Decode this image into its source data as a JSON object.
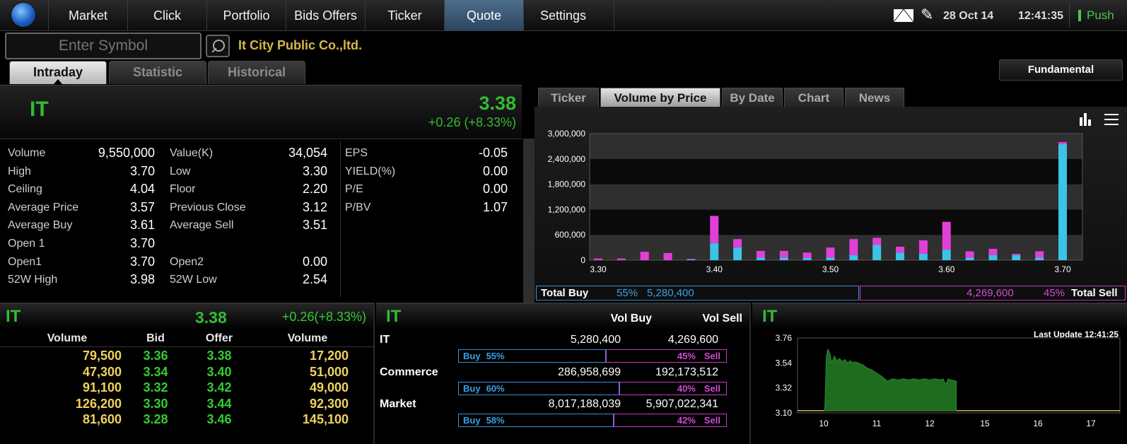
{
  "nav": {
    "items": [
      {
        "label": "Market",
        "active": false
      },
      {
        "label": "Click",
        "active": false
      },
      {
        "label": "Portfolio",
        "active": false
      },
      {
        "label": "Bids Offers",
        "active": false
      },
      {
        "label": "Ticker",
        "active": false
      },
      {
        "label": "Quote",
        "active": true
      },
      {
        "label": "Settings",
        "active": false
      }
    ],
    "date": "28 Oct 14",
    "time": "12:41:35",
    "push_label": "Push",
    "icons": [
      "mail-icon",
      "pen-icon"
    ]
  },
  "symbol_bar": {
    "placeholder": "Enter Symbol",
    "company": "It City Public Co.,ltd.",
    "tabs": [
      {
        "label": "Intraday",
        "active": true
      },
      {
        "label": "Statistic",
        "active": false
      },
      {
        "label": "Historical",
        "active": false
      }
    ],
    "fundamental_label": "Fundamental"
  },
  "quote": {
    "symbol": "IT",
    "last": "3.38",
    "change": "+0.26 (+8.33%)",
    "stats_col1": [
      {
        "label": "Volume",
        "value": "9,550,000"
      },
      {
        "label": "High",
        "value": "3.70"
      },
      {
        "label": "Ceiling",
        "value": "4.04"
      },
      {
        "label": "Average Price",
        "value": "3.57"
      },
      {
        "label": "Average Buy",
        "value": "3.61"
      },
      {
        "label": "Open 1",
        "value": "3.70"
      },
      {
        "label": "Open1",
        "value": "3.70"
      },
      {
        "label": "52W High",
        "value": "3.98"
      }
    ],
    "stats_col2": [
      {
        "label": "Value(K)",
        "value": "34,054"
      },
      {
        "label": "Low",
        "value": "3.30"
      },
      {
        "label": "Floor",
        "value": "2.20"
      },
      {
        "label": "Previous Close",
        "value": "3.12"
      },
      {
        "label": "Average Sell",
        "value": "3.51"
      },
      {
        "label": "",
        "value": ""
      },
      {
        "label": "Open2",
        "value": "0.00"
      },
      {
        "label": "52W Low",
        "value": "2.54"
      }
    ],
    "stats_col3": [
      {
        "label": "EPS",
        "value": "-0.05"
      },
      {
        "label": "YIELD(%)",
        "value": "0.00"
      },
      {
        "label": "P/E",
        "value": "0.00"
      },
      {
        "label": "P/BV",
        "value": "1.07"
      }
    ]
  },
  "right_tabs": [
    {
      "label": "Ticker",
      "active": false
    },
    {
      "label": "Volume by Price",
      "active": true
    },
    {
      "label": "By Date",
      "active": false
    },
    {
      "label": "Chart",
      "active": false
    },
    {
      "label": "News",
      "active": false
    }
  ],
  "chart_data": [
    {
      "type": "bar",
      "stacked": true,
      "x": [
        3.3,
        3.32,
        3.34,
        3.36,
        3.38,
        3.4,
        3.42,
        3.44,
        3.46,
        3.48,
        3.5,
        3.52,
        3.54,
        3.56,
        3.58,
        3.6,
        3.62,
        3.64,
        3.66,
        3.68,
        3.7
      ],
      "series": [
        {
          "name": "Total Buy",
          "color": "#3cc3e8",
          "values": [
            0,
            0,
            0,
            0,
            20000,
            400000,
            300000,
            60000,
            60000,
            50000,
            60000,
            120000,
            360000,
            180000,
            150000,
            250000,
            60000,
            120000,
            120000,
            60000,
            2750000
          ]
        },
        {
          "name": "Total Sell",
          "color": "#e040d8",
          "values": [
            40000,
            40000,
            200000,
            170000,
            10000,
            650000,
            200000,
            160000,
            160000,
            130000,
            240000,
            380000,
            170000,
            140000,
            320000,
            660000,
            150000,
            150000,
            30000,
            150000,
            50000
          ]
        }
      ],
      "x_ticks": [
        "3.30",
        "3.40",
        "3.50",
        "3.60",
        "3.70"
      ],
      "y_ticks": [
        "0",
        "600,000",
        "1,200,000",
        "1,800,000",
        "2,400,000",
        "3,000,000"
      ],
      "ylim": [
        0,
        3000000
      ],
      "grid": true,
      "legend": {
        "buy_label": "Total Buy",
        "buy_pct": "55%",
        "buy_vol": "5,280,400",
        "sell_label": "Total Sell",
        "sell_pct": "45%",
        "sell_vol": "4,269,600",
        "buy_color": "#3a9fe8",
        "sell_color": "#d64ad6"
      }
    },
    {
      "type": "area",
      "title": "IT",
      "last_update": "Last Update 12:41:25",
      "x_ticks": [
        "10",
        "11",
        "12",
        "15",
        "16",
        "17"
      ],
      "y_ticks": [
        "3.10",
        "3.32",
        "3.54",
        "3.76"
      ],
      "ylim": [
        3.1,
        3.76
      ],
      "baseline": 3.12,
      "x": [
        10.0,
        10.02,
        10.05,
        10.08,
        10.12,
        10.15,
        10.2,
        10.25,
        10.3,
        10.35,
        10.4,
        10.45,
        10.5,
        10.55,
        10.6,
        10.7,
        10.75,
        10.8,
        10.9,
        11.0,
        11.1,
        11.2,
        11.3,
        11.4,
        11.5,
        11.6,
        11.7,
        11.8,
        11.9,
        12.0,
        12.1,
        12.2,
        12.25,
        12.3,
        12.35,
        12.4,
        12.5
      ],
      "values": [
        3.12,
        3.12,
        3.6,
        3.66,
        3.62,
        3.54,
        3.6,
        3.56,
        3.58,
        3.55,
        3.57,
        3.54,
        3.56,
        3.54,
        3.55,
        3.53,
        3.52,
        3.5,
        3.48,
        3.45,
        3.42,
        3.38,
        3.4,
        3.39,
        3.4,
        3.39,
        3.4,
        3.39,
        3.4,
        3.39,
        3.4,
        3.39,
        3.4,
        3.35,
        3.4,
        3.39,
        3.38
      ],
      "color": "#1f6b1f"
    }
  ],
  "bid_offer": {
    "symbol": "IT",
    "last": "3.38",
    "change": "+0.26(+8.33%)",
    "headers": [
      "Volume",
      "Bid",
      "Offer",
      "Volume"
    ],
    "rows": [
      {
        "bid_vol": "79,500",
        "bid": "3.36",
        "offer": "3.38",
        "offer_vol": "17,200"
      },
      {
        "bid_vol": "47,300",
        "bid": "3.34",
        "offer": "3.40",
        "offer_vol": "51,000"
      },
      {
        "bid_vol": "91,100",
        "bid": "3.32",
        "offer": "3.42",
        "offer_vol": "49,000"
      },
      {
        "bid_vol": "126,200",
        "bid": "3.30",
        "offer": "3.44",
        "offer_vol": "92,300"
      },
      {
        "bid_vol": "81,600",
        "bid": "3.28",
        "offer": "3.46",
        "offer_vol": "145,100"
      }
    ]
  },
  "vol_compare": {
    "symbol": "IT",
    "headers": [
      "Vol Buy",
      "Vol Sell"
    ],
    "rows": [
      {
        "label": "IT",
        "vol_buy": "5,280,400",
        "vol_sell": "4,269,600",
        "buy_pct": "55%",
        "sell_pct": "45%",
        "buy_frac": 0.55
      },
      {
        "label": "Commerce",
        "vol_buy": "286,958,699",
        "vol_sell": "192,173,512",
        "buy_pct": "60%",
        "sell_pct": "40%",
        "buy_frac": 0.6
      },
      {
        "label": "Market",
        "vol_buy": "8,017,188,039",
        "vol_sell": "5,907,022,341",
        "buy_pct": "58%",
        "sell_pct": "42%",
        "buy_frac": 0.58
      }
    ],
    "buy_word": "Buy",
    "sell_word": "Sell"
  }
}
